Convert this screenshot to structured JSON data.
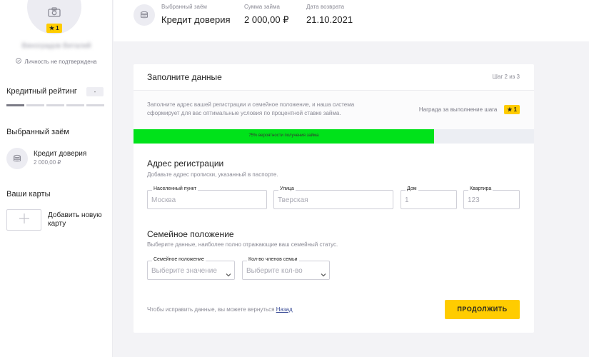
{
  "sidebar": {
    "avatar_badge": "1",
    "user_name": "Виноградов Виталий",
    "verify_status": "Личность не подтверждена",
    "rating_title": "Кредитный рейтинг",
    "rating_value": "-",
    "selected_loan_title": "Выбранный заём",
    "loan_name": "Кредит доверия",
    "loan_amount": "2 000,00 ₽",
    "cards_title": "Ваши карты",
    "add_card_label": "Добавить новую карту"
  },
  "header": {
    "loan_label": "Выбранный заём",
    "loan_value": "Кредит доверия",
    "amount_label": "Сумма займа",
    "amount_value": "2 000,00 ₽",
    "date_label": "Дата возврата",
    "date_value": "21.10.2021"
  },
  "form": {
    "title": "Заполните данные",
    "step": "Шаг 2 из 3",
    "info": "Заполните адрес вашей регистрации и семейное положение, и наша система сформирует для вас оптимальные условия по процентной ставке займа.",
    "reward_label": "Награда за выполнение шага",
    "reward_badge": "1",
    "progress_text": "75% вероятности получения займа",
    "progress_value": 0.75,
    "address": {
      "title": "Адрес регистрации",
      "subtitle": "Добавьте адрес прописки, указанный в паспорте.",
      "city_label": "Населенный пункт",
      "city_placeholder": "Москва",
      "street_label": "Улица",
      "street_placeholder": "Тверская",
      "house_label": "Дом",
      "house_placeholder": "1",
      "flat_label": "Квартира",
      "flat_placeholder": "123"
    },
    "family": {
      "title": "Семейное положение",
      "subtitle": "Выберите данные, наиболее полно отражающие ваш семейный статус.",
      "status_label": "Семейное положение",
      "status_value": "Выберите значение",
      "members_label": "Кол-во членов семьи",
      "members_value": "Выберите кол-во"
    },
    "fix_text": "Чтобы исправить данные, вы можете вернуться",
    "fix_link": "Назад",
    "submit_label": "ПРОДОЛЖИТЬ"
  },
  "colors": {
    "accent": "#ffcc00",
    "progress": "#00e21a",
    "link": "#3a4c96"
  },
  "icons": [
    "camera-icon",
    "star-icon",
    "shield-check-icon",
    "coins-icon",
    "plus-icon",
    "chevron-down-icon"
  ]
}
